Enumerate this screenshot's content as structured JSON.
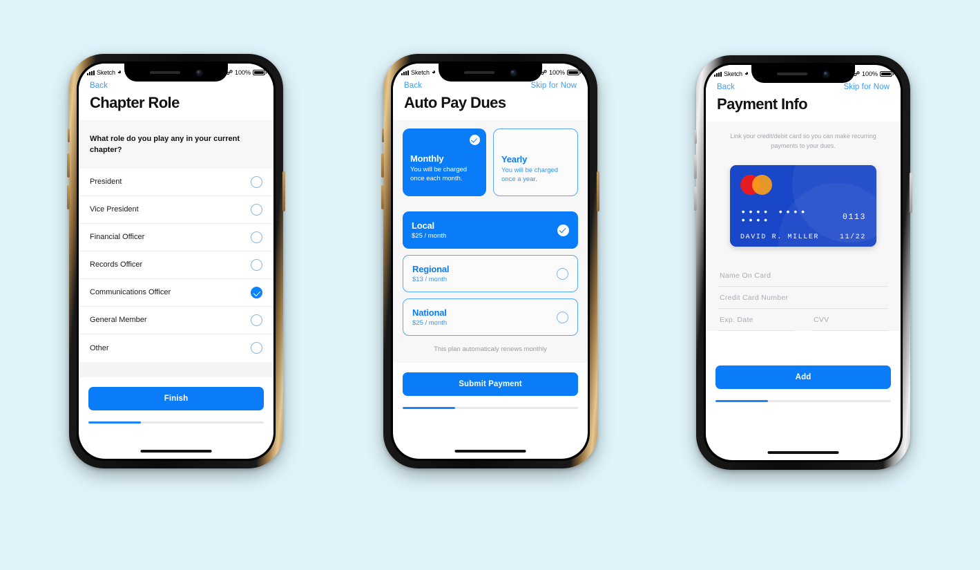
{
  "page": {
    "background_color": "#dff4fa"
  },
  "status_bar": {
    "carrier": "Sketch",
    "wifi_icon": "wifi-icon",
    "bluetooth_icon": "bluetooth-icon",
    "battery_percent": "100%",
    "signal_icon": "cellular-signal-icon"
  },
  "phones": [
    {
      "frame_color": "gold",
      "nav": {
        "back": "Back",
        "skip": ""
      },
      "title": "Chapter Role",
      "question": "What role do you play any in your current chapter?",
      "options": [
        {
          "label": "President",
          "selected": false
        },
        {
          "label": "Vice President",
          "selected": false
        },
        {
          "label": "Financial Officer",
          "selected": false
        },
        {
          "label": "Records Officer",
          "selected": false
        },
        {
          "label": "Communications Officer",
          "selected": true
        },
        {
          "label": "General Member",
          "selected": false
        },
        {
          "label": "Other",
          "selected": false
        }
      ],
      "cta": "Finish",
      "progress_percent": 30
    },
    {
      "frame_color": "gold",
      "nav": {
        "back": "Back",
        "skip": "Skip for Now"
      },
      "title": "Auto Pay Dues",
      "frequencies": [
        {
          "name": "Monthly",
          "desc": "You will be charged once each month.",
          "selected": true
        },
        {
          "name": "Yearly",
          "desc": "You will be charged once a year.",
          "selected": false
        }
      ],
      "plans": [
        {
          "name": "Local",
          "price": "$25 / month",
          "selected": true
        },
        {
          "name": "Regional",
          "price": "$13 / month",
          "selected": false
        },
        {
          "name": "National",
          "price": "$25 / month",
          "selected": false
        }
      ],
      "note": "This plan automaticaly renews monthly",
      "cta": "Submit Payment",
      "progress_percent": 30
    },
    {
      "frame_color": "silver",
      "nav": {
        "back": "Back",
        "skip": "Skip for Now"
      },
      "title": "Payment Info",
      "description": "Link your credit/debit card so you can make recurring payments to your dues.",
      "card": {
        "brand_icon": "mastercard-icon",
        "brand_color_left": "#e61c24",
        "brand_color_right": "#f79e1b",
        "card_color": "#1a46c8",
        "masked_digits": "••••  ••••  ••••",
        "last_four": "0113",
        "holder": "DAVID R. MILLER",
        "expiry": "11/22"
      },
      "fields": [
        {
          "placeholder": "Name On Card",
          "value": ""
        },
        {
          "placeholder": "Credit Card Number",
          "value": ""
        },
        {
          "placeholder": "Exp. Date",
          "value": ""
        },
        {
          "placeholder": "CVV",
          "value": ""
        }
      ],
      "cta": "Add",
      "progress_percent": 30
    }
  ],
  "colors": {
    "accent_blue": "#0a7cf7",
    "link_blue": "#3c9bfb",
    "card_blue": "#1a46c8",
    "page_bg": "#dff4fa"
  }
}
